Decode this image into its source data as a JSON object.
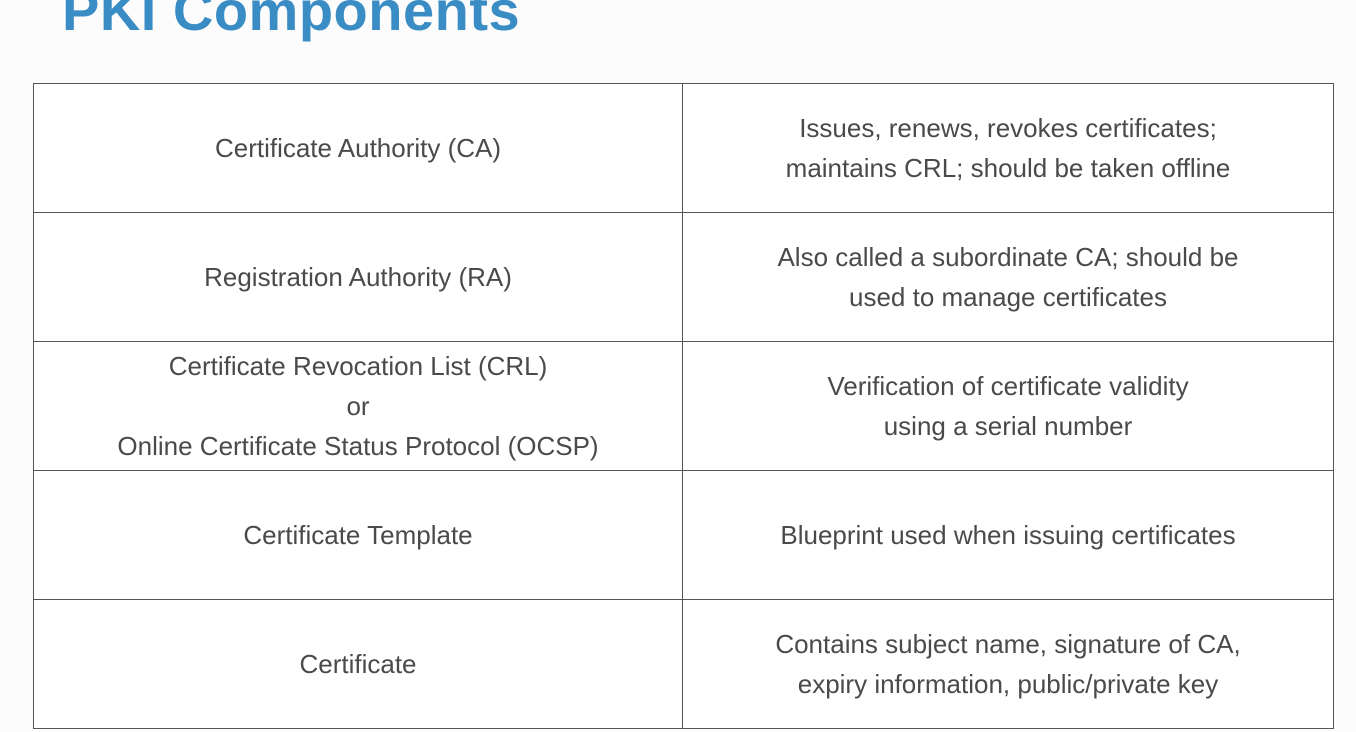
{
  "title": "PKI Components",
  "rows": [
    {
      "component": "Certificate Authority (CA)",
      "description": "Issues, renews, revokes certificates;\nmaintains CRL; should be taken offline"
    },
    {
      "component": "Registration Authority (RA)",
      "description": "Also called a subordinate CA; should be\nused to manage certificates"
    },
    {
      "component": "Certificate Revocation List (CRL)\nor\nOnline Certificate Status Protocol (OCSP)",
      "description": "Verification of certificate validity\nusing a serial number"
    },
    {
      "component": "Certificate Template",
      "description": "Blueprint used when issuing certificates"
    },
    {
      "component": "Certificate",
      "description": "Contains subject name, signature of CA,\nexpiry information, public/private key"
    }
  ]
}
